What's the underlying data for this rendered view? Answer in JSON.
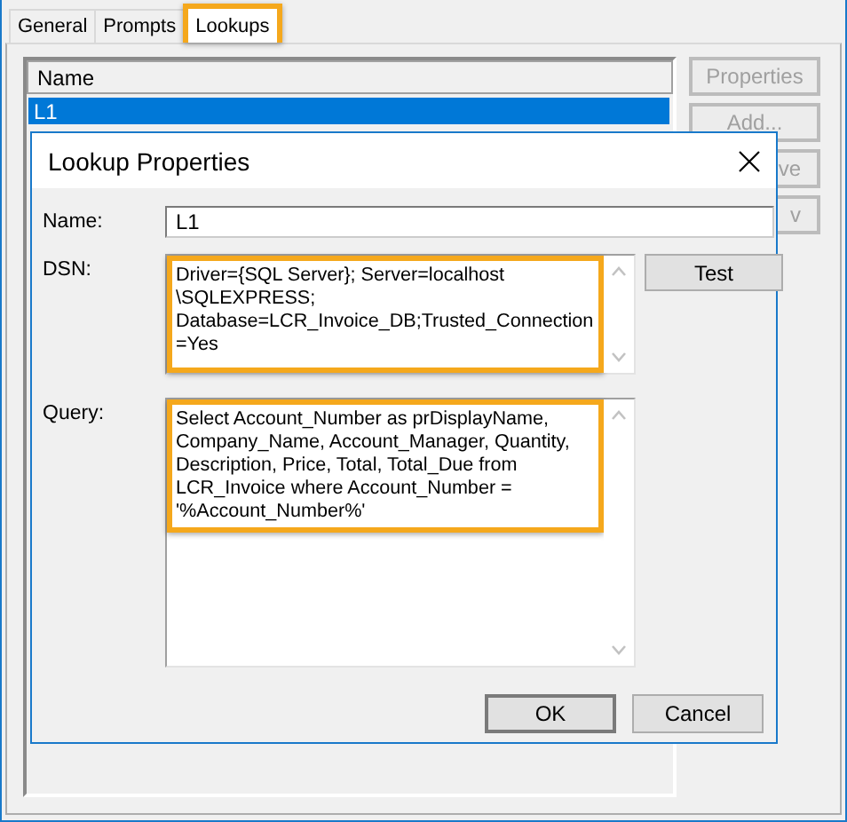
{
  "outer_window": {
    "tabs": [
      {
        "label": "General",
        "selected": false,
        "highlighted": false
      },
      {
        "label": "Prompts",
        "selected": false,
        "highlighted": false
      },
      {
        "label": "Lookups",
        "selected": true,
        "highlighted": true
      }
    ],
    "list": {
      "columns": [
        "Name"
      ],
      "rows": [
        {
          "name": "L1",
          "selected": true
        }
      ]
    },
    "side_buttons": [
      {
        "label": "Properties",
        "disabled": true
      },
      {
        "label": "Add...",
        "disabled": true
      },
      {
        "label": "ve",
        "disabled": true
      },
      {
        "label": "v",
        "disabled": true
      }
    ]
  },
  "dialog": {
    "title": "Lookup Properties",
    "fields": [
      {
        "kind": "line",
        "label": "Name:",
        "value": "L1"
      },
      {
        "kind": "area",
        "label": "DSN:",
        "highlighted": true,
        "button": "Test",
        "lines": [
          "Driver={SQL Server}; Server=localhost",
          "\\SQLEXPRESS;",
          "Database=LCR_Invoice_DB;Trusted_Connection",
          "=Yes"
        ]
      },
      {
        "kind": "area",
        "label": "Query:",
        "highlighted": true,
        "lines": [
          "Select Account_Number as prDisplayName,",
          "Company_Name, Account_Manager, Quantity,",
          "Description, Price, Total, Total_Due from",
          "LCR_Invoice where Account_Number =",
          "'%Account_Number%'"
        ]
      }
    ],
    "buttons": [
      {
        "label": "OK",
        "default": true
      },
      {
        "label": "Cancel",
        "default": false
      }
    ]
  }
}
